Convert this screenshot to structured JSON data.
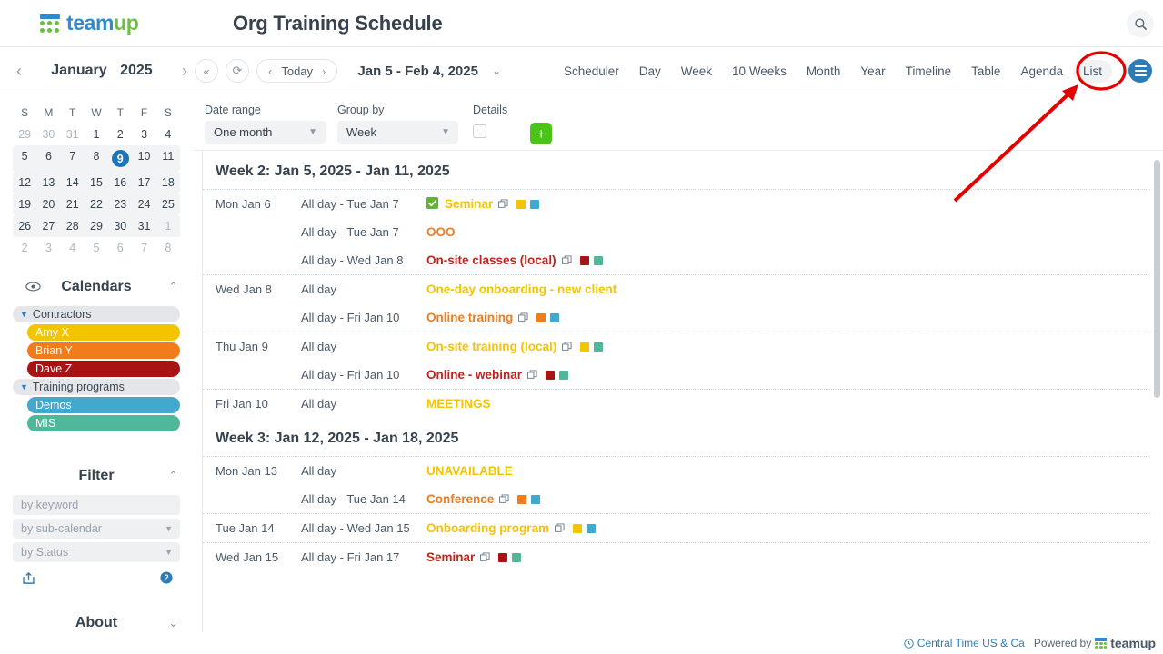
{
  "header": {
    "logo_text_1": "team",
    "logo_text_2": "up",
    "title": "Org Training Schedule",
    "search_icon": "search-icon"
  },
  "navbar": {
    "mini_prev": "‹",
    "mini_next": "›",
    "month": "January",
    "year": "2025",
    "first_btn": "«",
    "refresh_btn": "⟳",
    "prev_btn": "‹",
    "today_label": "Today",
    "next_btn": "›",
    "range_label": "Jan 5 - Feb 4, 2025",
    "range_caret": "⌄",
    "views": [
      {
        "label": "Scheduler",
        "active": false
      },
      {
        "label": "Day",
        "active": false
      },
      {
        "label": "Week",
        "active": false
      },
      {
        "label": "10 Weeks",
        "active": false
      },
      {
        "label": "Month",
        "active": false
      },
      {
        "label": "Year",
        "active": false
      },
      {
        "label": "Timeline",
        "active": false
      },
      {
        "label": "Table",
        "active": false
      },
      {
        "label": "Agenda",
        "active": false
      },
      {
        "label": "List",
        "active": true
      }
    ]
  },
  "minical": {
    "weekday_headers": [
      "S",
      "M",
      "T",
      "W",
      "T",
      "F",
      "S"
    ],
    "weeks": [
      {
        "shaded": false,
        "days": [
          {
            "n": "29",
            "muted": true
          },
          {
            "n": "30",
            "muted": true
          },
          {
            "n": "31",
            "muted": true
          },
          {
            "n": "1",
            "muted": false
          },
          {
            "n": "2",
            "muted": false
          },
          {
            "n": "3",
            "muted": false
          },
          {
            "n": "4",
            "muted": false
          }
        ]
      },
      {
        "shaded": true,
        "days": [
          {
            "n": "5",
            "muted": false
          },
          {
            "n": "6",
            "muted": false
          },
          {
            "n": "7",
            "muted": false
          },
          {
            "n": "8",
            "muted": false
          },
          {
            "n": "9",
            "muted": false,
            "today": true
          },
          {
            "n": "10",
            "muted": false
          },
          {
            "n": "11",
            "muted": false
          }
        ]
      },
      {
        "shaded": true,
        "days": [
          {
            "n": "12",
            "muted": false
          },
          {
            "n": "13",
            "muted": false
          },
          {
            "n": "14",
            "muted": false
          },
          {
            "n": "15",
            "muted": false
          },
          {
            "n": "16",
            "muted": false
          },
          {
            "n": "17",
            "muted": false
          },
          {
            "n": "18",
            "muted": false
          }
        ]
      },
      {
        "shaded": true,
        "days": [
          {
            "n": "19",
            "muted": false
          },
          {
            "n": "20",
            "muted": false
          },
          {
            "n": "21",
            "muted": false
          },
          {
            "n": "22",
            "muted": false
          },
          {
            "n": "23",
            "muted": false
          },
          {
            "n": "24",
            "muted": false
          },
          {
            "n": "25",
            "muted": false
          }
        ]
      },
      {
        "shaded": true,
        "days": [
          {
            "n": "26",
            "muted": false
          },
          {
            "n": "27",
            "muted": false
          },
          {
            "n": "28",
            "muted": false
          },
          {
            "n": "29",
            "muted": false
          },
          {
            "n": "30",
            "muted": false
          },
          {
            "n": "31",
            "muted": false
          },
          {
            "n": "1",
            "muted": true
          }
        ]
      },
      {
        "shaded": false,
        "days": [
          {
            "n": "2",
            "muted": true
          },
          {
            "n": "3",
            "muted": true
          },
          {
            "n": "4",
            "muted": true
          },
          {
            "n": "5",
            "muted": true
          },
          {
            "n": "6",
            "muted": true
          },
          {
            "n": "7",
            "muted": true
          },
          {
            "n": "8",
            "muted": true
          }
        ]
      }
    ]
  },
  "sidebar": {
    "calendars_title": "Calendars",
    "calendars_collapse": "⌃",
    "eye_icon": "eye-icon",
    "groups": [
      {
        "label": "Contractors",
        "items": [
          {
            "label": "Amy X",
            "color": "#f5c400"
          },
          {
            "label": "Brian Y",
            "color": "#f07c1e"
          },
          {
            "label": "Dave Z",
            "color": "#a81414"
          }
        ]
      },
      {
        "label": "Training programs",
        "items": [
          {
            "label": "Demos",
            "color": "#41a8ce"
          },
          {
            "label": "MIS",
            "color": "#50b79b"
          }
        ]
      }
    ],
    "filter_title": "Filter",
    "filter_collapse": "⌃",
    "filter_keyword_placeholder": "by keyword",
    "filter_subcalendar_label": "by sub-calendar",
    "filter_status_label": "by Status",
    "share_icon": "share-icon",
    "help_icon": "help-icon",
    "about_title": "About",
    "about_collapse": "⌄"
  },
  "toolbar": {
    "date_range_label": "Date range",
    "date_range_value": "One month",
    "group_by_label": "Group by",
    "group_by_value": "Week",
    "details_label": "Details",
    "details_checked": false,
    "add_label": "+"
  },
  "list": {
    "sections": [
      {
        "heading": "Week 2: Jan 5, 2025 - Jan 11, 2025",
        "days": [
          {
            "day": "Mon Jan 6",
            "events": [
              {
                "time": "All day - Tue Jan 7",
                "title": "Seminar",
                "color": "#f5c400",
                "checked": true,
                "repeat": true,
                "chips": [
                  "#f5c400",
                  "#41a8ce"
                ]
              },
              {
                "time": "All day - Tue Jan 7",
                "title": "OOO",
                "color": "#f07c1e",
                "checked": false,
                "repeat": false,
                "chips": []
              },
              {
                "time": "All day - Wed Jan 8",
                "title": "On-site classes (local)",
                "color": "#c3231d",
                "checked": false,
                "repeat": true,
                "chips": [
                  "#a81414",
                  "#50b79b"
                ]
              }
            ]
          },
          {
            "day": "Wed Jan 8",
            "events": [
              {
                "time": "All day",
                "title": "One-day onboarding - new client",
                "color": "#f5c400",
                "checked": false,
                "repeat": false,
                "chips": []
              },
              {
                "time": "All day - Fri Jan 10",
                "title": "Online training",
                "color": "#f07c1e",
                "checked": false,
                "repeat": true,
                "chips": [
                  "#f07c1e",
                  "#41a8ce"
                ]
              }
            ]
          },
          {
            "day": "Thu Jan 9",
            "events": [
              {
                "time": "All day",
                "title": "On-site training (local)",
                "color": "#f5c400",
                "checked": false,
                "repeat": true,
                "chips": [
                  "#f5c400",
                  "#50b79b"
                ]
              },
              {
                "time": "All day - Fri Jan 10",
                "title": "Online - webinar",
                "color": "#c3231d",
                "checked": false,
                "repeat": true,
                "chips": [
                  "#a81414",
                  "#50b79b"
                ]
              }
            ]
          },
          {
            "day": "Fri Jan 10",
            "events": [
              {
                "time": "All day",
                "title": "MEETINGS",
                "color": "#f5c400",
                "checked": false,
                "repeat": false,
                "chips": []
              }
            ]
          }
        ]
      },
      {
        "heading": "Week 3: Jan 12, 2025 - Jan 18, 2025",
        "days": [
          {
            "day": "Mon Jan 13",
            "events": [
              {
                "time": "All day",
                "title": "UNAVAILABLE",
                "color": "#f5c400",
                "checked": false,
                "repeat": false,
                "chips": []
              },
              {
                "time": "All day - Tue Jan 14",
                "title": "Conference",
                "color": "#f07c1e",
                "checked": false,
                "repeat": true,
                "chips": [
                  "#f07c1e",
                  "#41a8ce"
                ]
              }
            ]
          },
          {
            "day": "Tue Jan 14",
            "events": [
              {
                "time": "All day - Wed Jan 15",
                "title": "Onboarding program",
                "color": "#f5c400",
                "checked": false,
                "repeat": true,
                "chips": [
                  "#f5c400",
                  "#41a8ce"
                ]
              }
            ]
          },
          {
            "day": "Wed Jan 15",
            "events": [
              {
                "time": "All day - Fri Jan 17",
                "title": "Seminar",
                "color": "#c3231d",
                "checked": false,
                "repeat": true,
                "chips": [
                  "#a81414",
                  "#50b79b"
                ]
              }
            ]
          }
        ]
      }
    ]
  },
  "footer": {
    "timezone": "Central Time US & Ca",
    "powered_by": "Powered by",
    "logo_text_1": "team",
    "logo_text_2": "up"
  },
  "annotation": {
    "color": "#e50000",
    "target": "List"
  }
}
